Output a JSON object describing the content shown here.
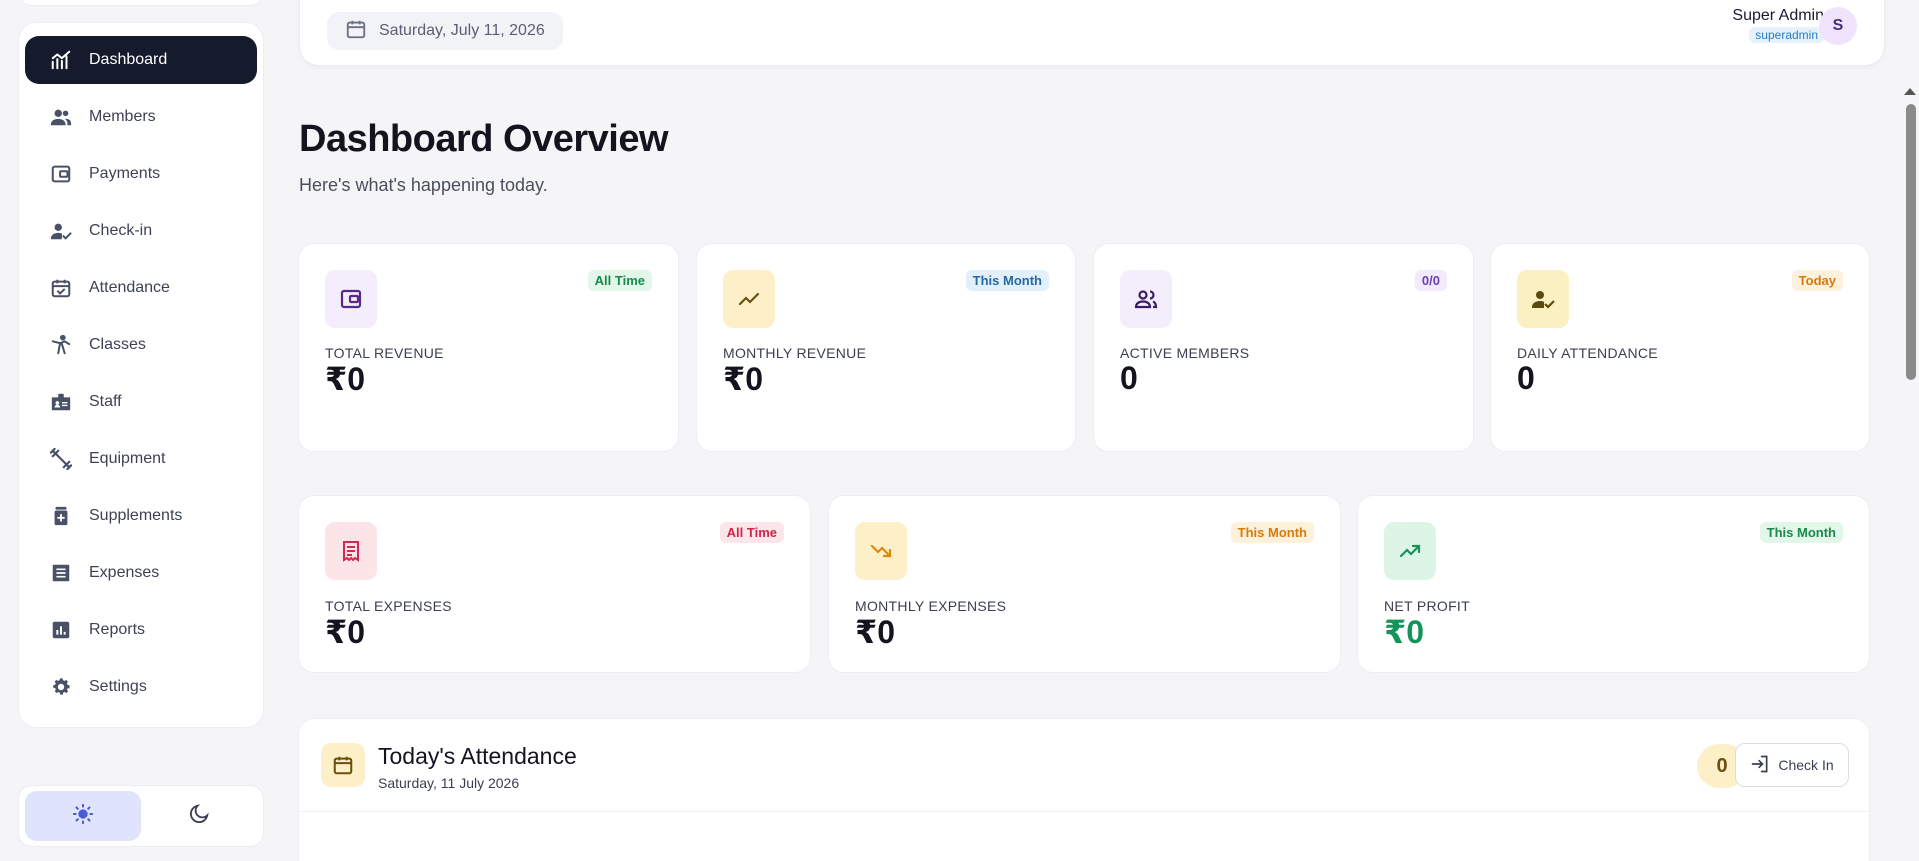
{
  "sidebar": {
    "items": [
      {
        "label": "Dashboard",
        "icon": "chart-line-icon",
        "active": true
      },
      {
        "label": "Members",
        "icon": "users-icon"
      },
      {
        "label": "Payments",
        "icon": "wallet-icon"
      },
      {
        "label": "Check-in",
        "icon": "user-check-icon"
      },
      {
        "label": "Attendance",
        "icon": "calendar-check-icon"
      },
      {
        "label": "Classes",
        "icon": "martial-arts-icon"
      },
      {
        "label": "Staff",
        "icon": "id-badge-icon"
      },
      {
        "label": "Equipment",
        "icon": "dumbbell-icon"
      },
      {
        "label": "Supplements",
        "icon": "supplement-jar-icon"
      },
      {
        "label": "Expenses",
        "icon": "receipt-list-icon"
      },
      {
        "label": "Reports",
        "icon": "bar-chart-icon"
      },
      {
        "label": "Settings",
        "icon": "gear-icon"
      }
    ],
    "theme": {
      "light_icon": "sun-icon",
      "dark_icon": "moon-icon",
      "active": "light"
    }
  },
  "header": {
    "date": "Saturday, July 11, 2026",
    "user_name": "Super Admin",
    "user_role": "superadmin",
    "avatar_initial": "S"
  },
  "main": {
    "title": "Dashboard Overview",
    "subtitle": "Here's what's happening today."
  },
  "stats_row1": [
    {
      "label": "TOTAL REVENUE",
      "value": "₹0",
      "badge": "All Time"
    },
    {
      "label": "MONTHLY REVENUE",
      "value": "₹0",
      "badge": "This Month"
    },
    {
      "label": "ACTIVE MEMBERS",
      "value": "0",
      "badge": "0/0"
    },
    {
      "label": "DAILY ATTENDANCE",
      "value": "0",
      "badge": "Today"
    }
  ],
  "stats_row2": [
    {
      "label": "TOTAL EXPENSES",
      "value": "₹0",
      "badge": "All Time"
    },
    {
      "label": "MONTHLY EXPENSES",
      "value": "₹0",
      "badge": "This Month"
    },
    {
      "label": "NET PROFIT",
      "value": "₹0",
      "badge": "This Month"
    }
  ],
  "attendance": {
    "title": "Today's Attendance",
    "date": "Saturday, 11 July 2026",
    "count": "0",
    "checkin_label": "Check In"
  },
  "colors": {
    "sidebar_active": "#151a2d",
    "accent_purple": "#5b2a86",
    "net_profit_green": "#14935a"
  }
}
